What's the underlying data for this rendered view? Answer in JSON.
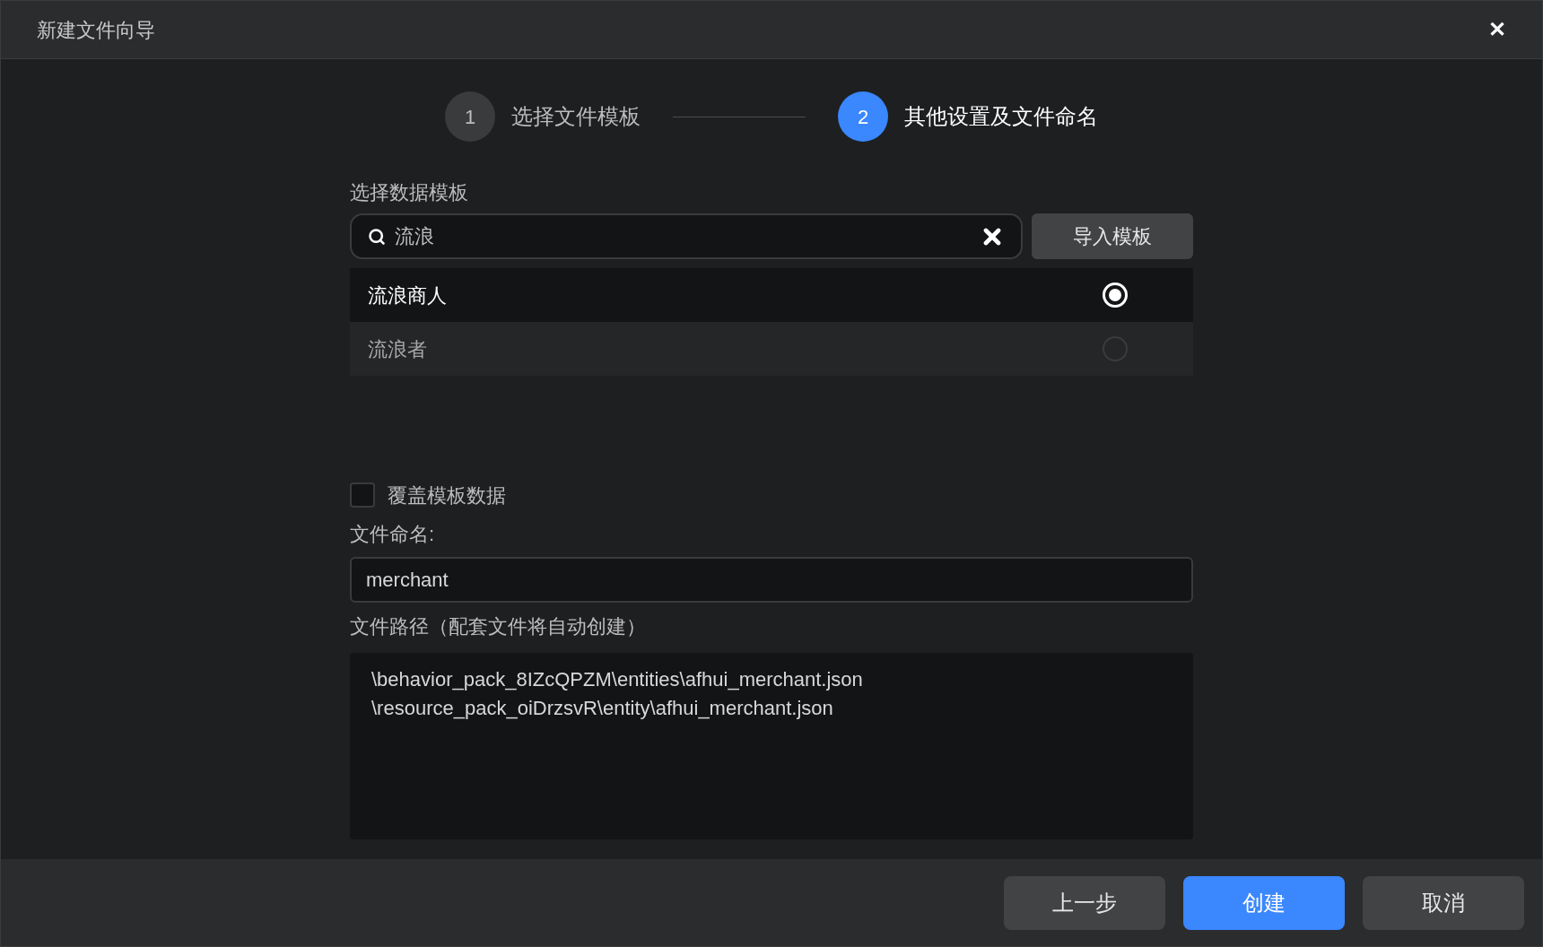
{
  "window": {
    "title": "新建文件向导",
    "close": "✕"
  },
  "steps": [
    {
      "number": "1",
      "label": "选择文件模板",
      "selected": false
    },
    {
      "number": "2",
      "label": "其他设置及文件命名",
      "selected": true
    }
  ],
  "template_section": {
    "label": "选择数据模板",
    "search": {
      "value": "流浪"
    },
    "import_button": "导入模板",
    "items": [
      {
        "label": "流浪商人",
        "selected": true
      },
      {
        "label": "流浪者",
        "selected": false
      }
    ]
  },
  "overwrite": {
    "label": "覆盖模板数据",
    "checked": false
  },
  "file_name": {
    "label": "文件命名:",
    "value": "merchant"
  },
  "file_path": {
    "label": "文件路径（配套文件将自动创建）",
    "lines": [
      "\\behavior_pack_8IZcQPZM\\entities\\afhui_merchant.json",
      "\\resource_pack_oiDrzsvR\\entity\\afhui_merchant.json"
    ]
  },
  "buttons": [
    {
      "label": "上一步",
      "kind": "secondary"
    },
    {
      "label": "创建",
      "kind": "primary"
    },
    {
      "label": "取消",
      "kind": "secondary"
    }
  ]
}
